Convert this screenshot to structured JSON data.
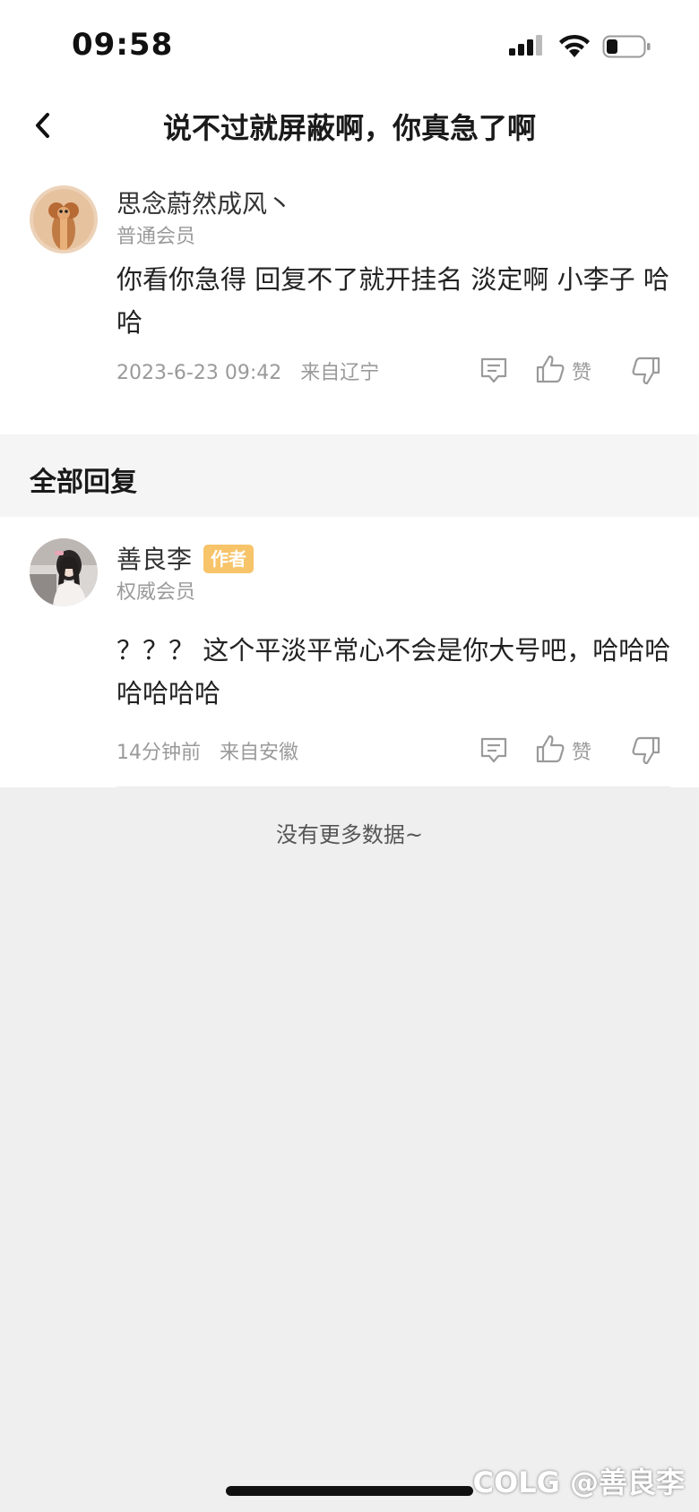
{
  "status_bar": {
    "time": "09:58"
  },
  "nav": {
    "title": "说不过就屏蔽啊，你真急了啊"
  },
  "top_comment": {
    "user_name": "思念蔚然成风丶",
    "user_level": "普通会员",
    "text": "你看你急得  回复不了就开挂名  淡定啊  小李子 哈哈",
    "timestamp": "2023-6-23 09:42",
    "location": "来自辽宁",
    "like_label": "赞"
  },
  "replies_section": {
    "title": "全部回复"
  },
  "replies": [
    {
      "user_name": "善良李",
      "badge": "作者",
      "user_level": "权威会员",
      "text": "？？？ 这个平淡平常心不会是你大号吧，哈哈哈哈哈哈哈",
      "timestamp": "14分钟前",
      "location": "来自安徽",
      "like_label": "赞"
    }
  ],
  "footer": {
    "no_more": "没有更多数据~"
  },
  "watermark": "COLG @善良李",
  "colors": {
    "badge": "#f7c46a",
    "background": "#efefef"
  }
}
